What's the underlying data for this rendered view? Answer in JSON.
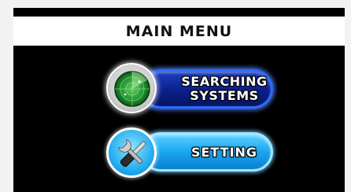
{
  "menu": {
    "title": "MAIN MENU",
    "items": [
      {
        "line1": "SEARCHING",
        "line2": "SYSTEMS",
        "icon": "radar-icon"
      },
      {
        "line1": "SETTING",
        "icon": "wrench-screwdriver-icon"
      }
    ]
  },
  "colors": {
    "screen_bg": "#000000",
    "title_bg": "#ffffff",
    "search_button": "#0b1f8a",
    "setting_button": "#1aa6ee"
  }
}
